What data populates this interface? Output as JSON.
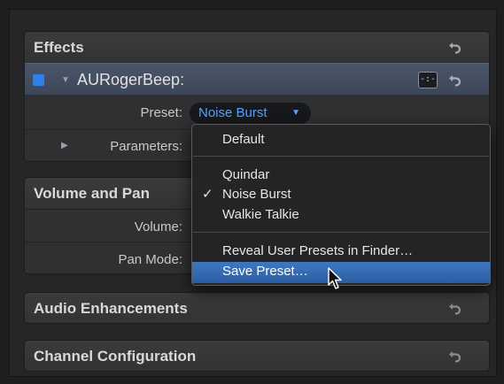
{
  "sections": {
    "effects": {
      "title": "Effects"
    },
    "volume_pan": {
      "title": "Volume and Pan"
    },
    "audio_enhancements": {
      "title": "Audio Enhancements"
    },
    "channel_configuration": {
      "title": "Channel Configuration"
    }
  },
  "effect": {
    "name": "AURogerBeep:",
    "enabled": true,
    "plugin_button_label": "-:-",
    "preset_label": "Preset:",
    "preset_value": "Noise Burst",
    "parameters_label": "Parameters:"
  },
  "volume_pan": {
    "volume_label": "Volume:",
    "pan_mode_label": "Pan Mode:"
  },
  "preset_menu": {
    "items": [
      {
        "label": "Default",
        "checked": false
      },
      {
        "label": "Quindar",
        "checked": false
      },
      {
        "label": "Noise Burst",
        "checked": true
      },
      {
        "label": "Walkie Talkie",
        "checked": false
      },
      {
        "label": "Reveal User Presets in Finder…",
        "checked": false
      },
      {
        "label": "Save Preset…",
        "checked": false,
        "highlighted": true
      }
    ],
    "check_glyph": "✓"
  },
  "colors": {
    "accent_blue": "#2e7ff0",
    "highlight": "#3a6fb6",
    "popup_text": "#5aa2ff"
  },
  "icons": {
    "reset": "reset-arrow-icon",
    "cursor": "mouse-pointer-icon"
  }
}
